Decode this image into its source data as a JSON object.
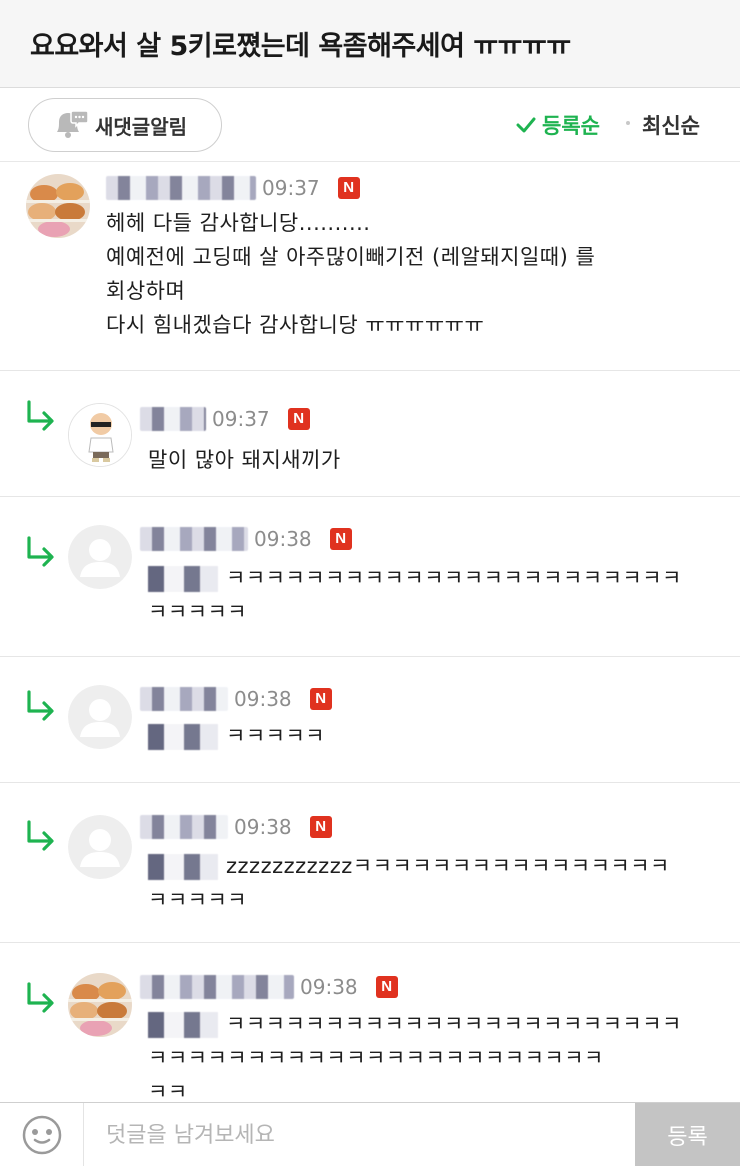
{
  "header": {
    "title": "요요와서 살 5키로쪘는데 욕좀해주세여 ㅠㅠㅠㅠ"
  },
  "toolbar": {
    "alarm_label": "새댓글알림",
    "sort_registered": "등록순",
    "sort_latest": "최신순",
    "active_sort_color": "#1eb350"
  },
  "comments": [
    {
      "time": "09:37",
      "badge": "N",
      "lines": [
        "헤헤 다들 감사합니당..........",
        "예예전에 고딩때 살 아주많이빼기전 (레알돼지일때) 를",
        "회상하며",
        "다시 힘내겠습다 감사합니당 ㅠㅠㅠㅠㅠㅠ"
      ]
    },
    {
      "time": "09:37",
      "badge": "N",
      "lines": [
        "말이 많아 돼지새끼가"
      ]
    },
    {
      "time": "09:38",
      "badge": "N",
      "lines": [
        "ㅋㅋㅋㅋㅋㅋㅋㅋㅋㅋㅋㅋㅋㅋㅋㅋㅋㅋㅋㅋㅋㅋㅋ",
        "ㅋㅋㅋㅋㅋ"
      ]
    },
    {
      "time": "09:38",
      "badge": "N",
      "lines": [
        "ㅋㅋㅋㅋㅋ"
      ]
    },
    {
      "time": "09:38",
      "badge": "N",
      "lines": [
        "zzzzzzzzzzzㅋㅋㅋㅋㅋㅋㅋㅋㅋㅋㅋㅋㅋㅋㅋㅋ",
        "ㅋㅋㅋㅋㅋ"
      ]
    },
    {
      "time": "09:38",
      "badge": "N",
      "lines": [
        "ㅋㅋㅋㅋㅋㅋㅋㅋㅋㅋㅋㅋㅋㅋㅋㅋㅋㅋㅋㅋㅋㅋㅋ",
        "ㅋㅋㅋㅋㅋㅋㅋㅋㅋㅋㅋㅋㅋㅋㅋㅋㅋㅋㅋㅋㅋㅋㅋ",
        "ㅋㅋ"
      ]
    }
  ],
  "footer": {
    "input_placeholder": "덧글을 남겨보세요",
    "submit_label": "등록"
  },
  "icons": {
    "alarm": "bell-comment-icon",
    "check": "check-icon",
    "reply": "reply-arrow-icon",
    "emoji": "emoji-icon"
  }
}
